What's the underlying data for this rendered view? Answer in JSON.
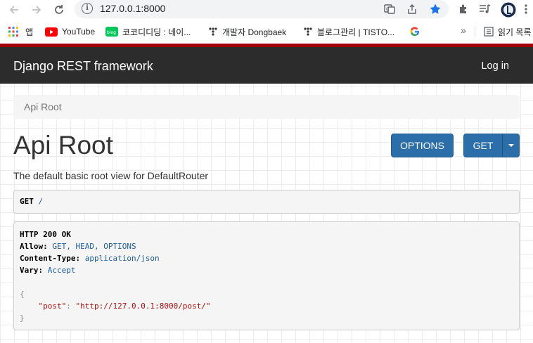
{
  "browser": {
    "url": "127.0.0.1:8000",
    "bookmarks": [
      {
        "label": "앱",
        "icon": "apps-grid-icon"
      },
      {
        "label": "YouTube",
        "icon": "youtube-icon"
      },
      {
        "label": "코코디디딩 : 네이...",
        "icon": "naver-blog-icon"
      },
      {
        "label": "개발자 Dongbaek",
        "icon": "tistory-icon"
      },
      {
        "label": "블로그관리 | TISTO...",
        "icon": "tistory-icon"
      },
      {
        "label": "",
        "icon": "google-icon"
      }
    ],
    "more_label": "»",
    "reading_list_label": "읽기 목록"
  },
  "header": {
    "brand": "Django REST framework",
    "login": "Log in"
  },
  "breadcrumb": "Api Root",
  "main": {
    "title": "Api Root",
    "options_button": "OPTIONS",
    "get_button": "GET",
    "description": "The default basic root view for DefaultRouter"
  },
  "request": {
    "method": "GET",
    "path": "/"
  },
  "response": {
    "status": "HTTP 200 OK",
    "headers": [
      {
        "name": "Allow:",
        "value": "GET, HEAD, OPTIONS"
      },
      {
        "name": "Content-Type:",
        "value": "application/json"
      },
      {
        "name": "Vary:",
        "value": "Accept"
      }
    ],
    "body_open": "{",
    "body_key": "\"post\"",
    "body_colon": ": ",
    "body_value": "\"http://127.0.0.1:8000/post/\"",
    "body_close": "}"
  },
  "colors": {
    "navbar": "#2c2c2c",
    "accent_bar": "#a30000",
    "button": "#2c6eaa"
  }
}
